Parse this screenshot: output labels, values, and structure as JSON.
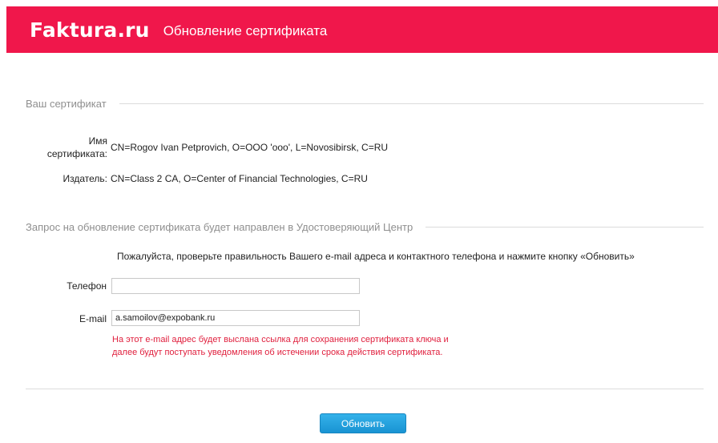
{
  "header": {
    "logo": "Faktura.ru",
    "title": "Обновление сертификата"
  },
  "colors": {
    "brand": "#f0174b",
    "button": "#1993d3",
    "hint": "#e0203e"
  },
  "certificate_section": {
    "legend": "Ваш сертификат",
    "name_label_line1": "Имя",
    "name_label_line2": "сертификата:",
    "name_value": "CN=Rogov Ivan Petprovich, O=OOO 'ooo', L=Novosibirsk, C=RU",
    "issuer_label": "Издатель:",
    "issuer_value": "CN=Class 2 CA, O=Center of Financial Technologies, C=RU"
  },
  "request_section": {
    "legend": "Запрос на обновление сертификата будет направлен в Удостоверяющий Центр",
    "notice": "Пожалуйста, проверьте правильность Вашего e-mail адреса и контактного телефона и нажмите кнопку «Обновить»",
    "phone_label": "Телефон",
    "phone_value": "",
    "email_label": "E-mail",
    "email_value": "a.samoilov@expobank.ru",
    "hint_line1": "На этот e-mail адрес будет выслана ссылка для сохранения сертификата ключа и",
    "hint_line2": "далее будут поступать уведомления об истечении срока действия сертификата."
  },
  "actions": {
    "submit_label": "Обновить"
  }
}
